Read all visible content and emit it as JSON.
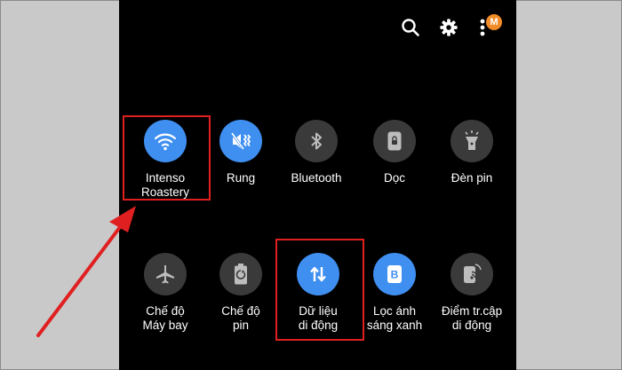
{
  "colors": {
    "accent": "#3f8ff1",
    "tile_off": "#3a3a3a",
    "highlight": "#e02020",
    "badge": "#f28c28"
  },
  "header": {
    "icons": [
      "search-icon",
      "gear-icon",
      "more-vertical-icon"
    ],
    "badge_letter": "M"
  },
  "tiles": [
    {
      "label": "Intenso\nRoastery",
      "icon": "wifi-icon",
      "state": "on"
    },
    {
      "label": "Rung",
      "icon": "vibrate-icon",
      "state": "on"
    },
    {
      "label": "Bluetooth",
      "icon": "bluetooth-icon",
      "state": "off"
    },
    {
      "label": "Dọc",
      "icon": "portrait-lock-icon",
      "state": "off"
    },
    {
      "label": "Đèn pin",
      "icon": "flashlight-icon",
      "state": "off"
    },
    {
      "label": "Chế độ\nMáy bay",
      "icon": "airplane-icon",
      "state": "off"
    },
    {
      "label": "Chế độ\npin",
      "icon": "battery-saver-icon",
      "state": "off"
    },
    {
      "label": "Dữ liệu\ndi động",
      "icon": "mobile-data-icon",
      "state": "on"
    },
    {
      "label": "Lọc ánh\nsáng xanh",
      "icon": "blue-light-filter-icon",
      "state": "on"
    },
    {
      "label": "Điểm tr.cập\ndi động",
      "icon": "mobile-hotspot-icon",
      "state": "off"
    }
  ]
}
